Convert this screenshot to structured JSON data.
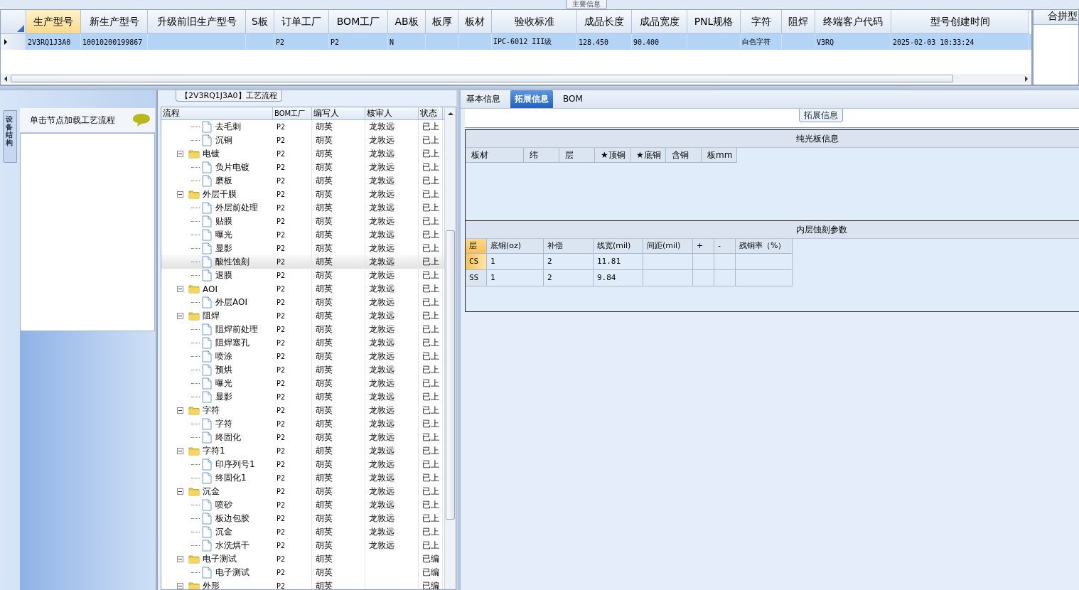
{
  "top_panel_title": "主要信息",
  "main_grid": {
    "columns": [
      {
        "label": "生产型号",
        "selected": true
      },
      {
        "label": "新生产型号",
        "selected": false
      },
      {
        "label": "升级前旧生产型号",
        "selected": false
      },
      {
        "label": "S板",
        "selected": false
      },
      {
        "label": "订单工厂",
        "selected": false
      },
      {
        "label": "BOM工厂",
        "selected": false
      },
      {
        "label": "AB板",
        "selected": false
      },
      {
        "label": "板厚",
        "selected": false
      },
      {
        "label": "板材",
        "selected": false
      },
      {
        "label": "验收标准",
        "selected": false
      },
      {
        "label": "成品长度",
        "selected": false
      },
      {
        "label": "成品宽度",
        "selected": false
      },
      {
        "label": "PNL规格",
        "selected": false
      },
      {
        "label": "字符",
        "selected": false
      },
      {
        "label": "阻焊",
        "selected": false
      },
      {
        "label": "终端客户代码",
        "selected": false
      },
      {
        "label": "型号创建时间",
        "selected": false
      }
    ],
    "rows": [
      {
        "selected": true,
        "cells": [
          "2V3RQ1J3A0",
          "10010200199867",
          null,
          null,
          "P2",
          "P2",
          "N",
          null,
          null,
          "IPC-6012 III级",
          "128.450",
          "90.400",
          null,
          "白色字符",
          null,
          "V3RQ",
          "2025-02-03 10:33:24"
        ]
      }
    ]
  },
  "merge_panel": {
    "header": "合拼型"
  },
  "process_flow": {
    "title": "【2V3RQ1J3A0】工艺流程",
    "side_tab": "设备结构",
    "hint": "单击节点加载工艺流程",
    "columns": [
      "流程",
      "BOM工厂",
      "编写人",
      "核审人",
      "状态"
    ],
    "nodes": [
      {
        "children": [
          {
            "label": "去毛刺",
            "bom_factory": "P2",
            "writer": "胡英",
            "reviewer": "龙敦远",
            "status": "已上",
            "selected": false
          },
          {
            "label": "沉铜",
            "bom_factory": "P2",
            "writer": "胡英",
            "reviewer": "龙敦远",
            "status": "已上",
            "selected": false
          }
        ]
      },
      {
        "label": "电镀",
        "expanded": true,
        "bom_factory": "P2",
        "writer": "胡英",
        "reviewer": "龙敦远",
        "status": "已上",
        "selected": false,
        "children": [
          {
            "label": "负片电镀",
            "bom_factory": "P2",
            "writer": "胡英",
            "reviewer": "龙敦远",
            "status": "已上",
            "selected": false
          },
          {
            "label": "磨板",
            "bom_factory": "P2",
            "writer": "胡英",
            "reviewer": "龙敦远",
            "status": "已上",
            "selected": false
          }
        ]
      },
      {
        "label": "外层干膜",
        "expanded": true,
        "bom_factory": "P2",
        "writer": "胡英",
        "reviewer": "龙敦远",
        "status": "已上",
        "selected": false,
        "children": [
          {
            "label": "外层前处理",
            "bom_factory": "P2",
            "writer": "胡英",
            "reviewer": "龙敦远",
            "status": "已上",
            "selected": false
          },
          {
            "label": "贴膜",
            "bom_factory": "P2",
            "writer": "胡英",
            "reviewer": "龙敦远",
            "status": "已上",
            "selected": false
          },
          {
            "label": "曝光",
            "bom_factory": "P2",
            "writer": "胡英",
            "reviewer": "龙敦远",
            "status": "已上",
            "selected": false
          },
          {
            "label": "显影",
            "bom_factory": "P2",
            "writer": "胡英",
            "reviewer": "龙敦远",
            "status": "已上",
            "selected": false
          },
          {
            "label": "酸性蚀刻",
            "bom_factory": "P2",
            "writer": "胡英",
            "reviewer": "龙敦远",
            "status": "已上",
            "selected": true
          },
          {
            "label": "退膜",
            "bom_factory": "P2",
            "writer": "胡英",
            "reviewer": "龙敦远",
            "status": "已上",
            "selected": false
          }
        ]
      },
      {
        "label": "AOI",
        "expanded": true,
        "bom_factory": "P2",
        "writer": "胡英",
        "reviewer": "龙敦远",
        "status": "已上",
        "selected": false,
        "children": [
          {
            "label": "外层AOI",
            "bom_factory": "P2",
            "writer": "胡英",
            "reviewer": "龙敦远",
            "status": "已上",
            "selected": false
          }
        ]
      },
      {
        "label": "阻焊",
        "expanded": true,
        "bom_factory": "P2",
        "writer": "胡英",
        "reviewer": "龙敦远",
        "status": "已上",
        "selected": false,
        "children": [
          {
            "label": "阻焊前处理",
            "bom_factory": "P2",
            "writer": "胡英",
            "reviewer": "龙敦远",
            "status": "已上",
            "selected": false
          },
          {
            "label": "阻焊塞孔",
            "bom_factory": "P2",
            "writer": "胡英",
            "reviewer": "龙敦远",
            "status": "已上",
            "selected": false
          },
          {
            "label": "喷涂",
            "bom_factory": "P2",
            "writer": "胡英",
            "reviewer": "龙敦远",
            "status": "已上",
            "selected": false
          },
          {
            "label": "预烘",
            "bom_factory": "P2",
            "writer": "胡英",
            "reviewer": "龙敦远",
            "status": "已上",
            "selected": false
          },
          {
            "label": "曝光",
            "bom_factory": "P2",
            "writer": "胡英",
            "reviewer": "龙敦远",
            "status": "已上",
            "selected": false
          },
          {
            "label": "显影",
            "bom_factory": "P2",
            "writer": "胡英",
            "reviewer": "龙敦远",
            "status": "已上",
            "selected": false
          }
        ]
      },
      {
        "label": "字符",
        "expanded": true,
        "bom_factory": "P2",
        "writer": "胡英",
        "reviewer": "龙敦远",
        "status": "已上",
        "selected": false,
        "children": [
          {
            "label": "字符",
            "bom_factory": "P2",
            "writer": "胡英",
            "reviewer": "龙敦远",
            "status": "已上",
            "selected": false
          },
          {
            "label": "终固化",
            "bom_factory": "P2",
            "writer": "胡英",
            "reviewer": "龙敦远",
            "status": "已上",
            "selected": false
          }
        ]
      },
      {
        "label": "字符1",
        "expanded": true,
        "bom_factory": "P2",
        "writer": "胡英",
        "reviewer": "龙敦远",
        "status": "已上",
        "selected": false,
        "children": [
          {
            "label": "印序列号1",
            "bom_factory": "P2",
            "writer": "胡英",
            "reviewer": "龙敦远",
            "status": "已上",
            "selected": false
          },
          {
            "label": "终固化1",
            "bom_factory": "P2",
            "writer": "胡英",
            "reviewer": "龙敦远",
            "status": "已上",
            "selected": false
          }
        ]
      },
      {
        "label": "沉金",
        "expanded": true,
        "bom_factory": "P2",
        "writer": "胡英",
        "reviewer": "龙敦远",
        "status": "已上",
        "selected": false,
        "children": [
          {
            "label": "喷砂",
            "bom_factory": "P2",
            "writer": "胡英",
            "reviewer": "龙敦远",
            "status": "已上",
            "selected": false
          },
          {
            "label": "板边包胶",
            "bom_factory": "P2",
            "writer": "胡英",
            "reviewer": "龙敦远",
            "status": "已上",
            "selected": false
          },
          {
            "label": "沉金",
            "bom_factory": "P2",
            "writer": "胡英",
            "reviewer": "龙敦远",
            "status": "已上",
            "selected": false
          },
          {
            "label": "水洗烘干",
            "bom_factory": "P2",
            "writer": "胡英",
            "reviewer": "龙敦远",
            "status": "已上",
            "selected": false
          }
        ]
      },
      {
        "label": "电子测试",
        "expanded": true,
        "bom_factory": "P2",
        "writer": "胡英",
        "status": "已编",
        "selected": false,
        "children": [
          {
            "label": "电子测试",
            "bom_factory": "P2",
            "writer": "胡英",
            "status": "已编",
            "selected": false
          }
        ]
      },
      {
        "label": "外形",
        "expanded": true,
        "bom_factory": "P2",
        "writer": "胡英",
        "status": "已编",
        "selected": false
      }
    ]
  },
  "detail_panel": {
    "tabs": [
      {
        "label": "基本信息",
        "selected": false
      },
      {
        "label": "拓展信息",
        "selected": true
      },
      {
        "label": "BOM",
        "selected": false
      }
    ],
    "group_title": "拓展信息",
    "plain_board": {
      "title": "纯光板信息",
      "columns": [
        "板材",
        "纬",
        "层",
        "★顶铜",
        "★底铜",
        "含铜",
        "板mm"
      ]
    },
    "inner_etch": {
      "title": "内层蚀刻参数",
      "columns": [
        "层",
        "底铜(oz)",
        "补偿",
        "线宽(mil)",
        "间距(mil)",
        "+",
        "-",
        "残铜率（%）"
      ],
      "rows": [
        {
          "selected": true,
          "cells": [
            "CS",
            "1",
            "2",
            "11.81",
            null,
            null,
            null,
            null
          ]
        },
        {
          "selected": false,
          "cells": [
            "SS",
            "1",
            "2",
            "9.84",
            null,
            null,
            null,
            null
          ]
        }
      ]
    }
  }
}
